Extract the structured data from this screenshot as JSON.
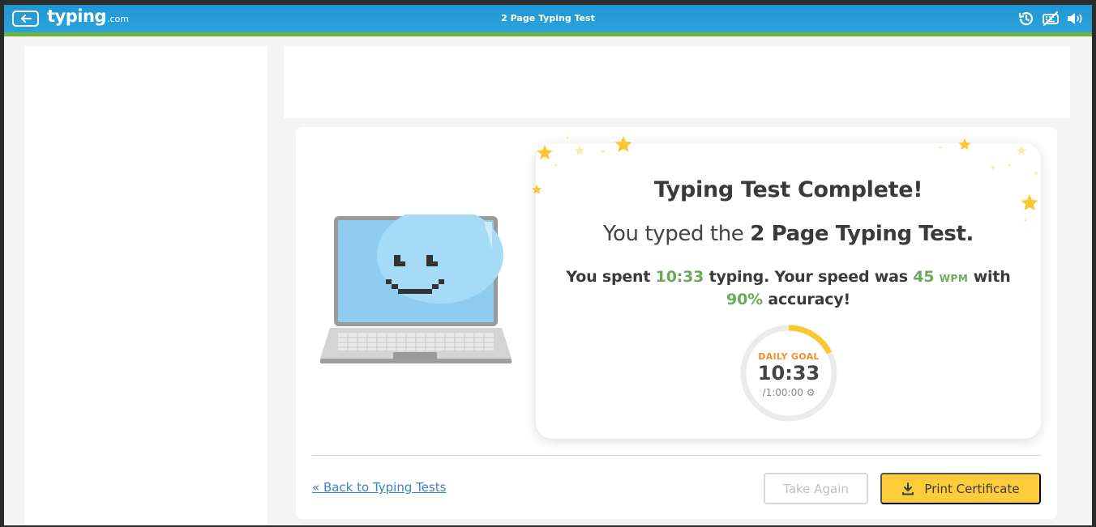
{
  "header": {
    "logo_main": "typing",
    "logo_suffix": ".com",
    "page_title": "2 Page Typing Test",
    "icons": [
      "back-arrow-icon",
      "history-icon",
      "keyboard-off-icon",
      "volume-icon"
    ]
  },
  "result": {
    "title": "Typing Test Complete!",
    "subtitle_prefix": "You typed the",
    "test_name": "2 Page Typing Test.",
    "stats": {
      "spent_prefix": "You spent",
      "time": "10:33",
      "speed_prefix": "typing. Your speed was",
      "wpm_value": "45",
      "wpm_unit": "WPM",
      "accuracy_prefix": "with",
      "accuracy": "90%",
      "accuracy_suffix": "accuracy!"
    }
  },
  "daily_goal": {
    "label": "DAILY GOAL",
    "time": "10:33",
    "target": "/1:00:00",
    "progress": 0.176
  },
  "actions": {
    "back_link": "« Back to Typing Tests",
    "take_again": "Take Again",
    "print_certificate": "Print Certificate"
  },
  "colors": {
    "topbar": "#1f97d3",
    "stripe": "#6db33f",
    "accent_green": "#6aaa58",
    "goal_orange": "#f2902b",
    "print_yellow": "#fdcc3a",
    "star_yellow": "#fbc731"
  }
}
